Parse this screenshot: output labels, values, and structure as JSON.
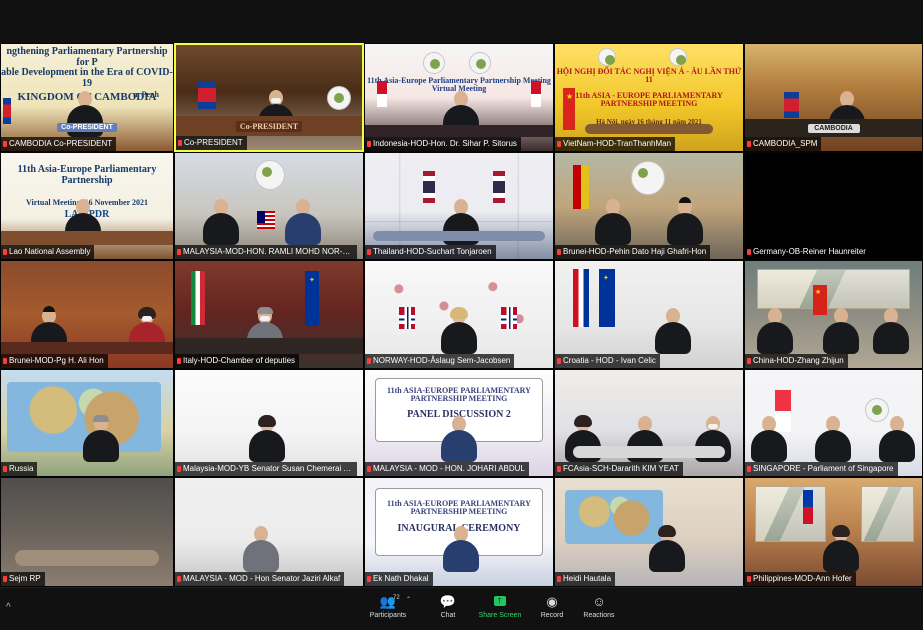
{
  "toolbar": {
    "left_chevron": "^",
    "participants_label": "Participants",
    "participants_count": "72",
    "chat_label": "Chat",
    "share_screen_label": "Share Screen",
    "record_label": "Record",
    "reactions_label": "Reactions"
  },
  "tiles": [
    {
      "label": "CAMBODIA Co-PRESIDENT",
      "banner": [
        "ngthening Parliamentary Partnership for P",
        "able Development in the Era of COVID-19",
        "KINGDOM OF CAMBODIA",
        "16 N",
        "m Penh"
      ],
      "nameplate": "Co-PRESIDENT",
      "colors": {
        "accent": "#173a67"
      }
    },
    {
      "label": "Co-PRESIDENT",
      "nameplate": "Co-PRESIDENT",
      "colors": {
        "accent": "#5a2d1e"
      }
    },
    {
      "label": "Indonesia-HOD-Hon. Dr. Sihar P. Sitorus",
      "banner": [
        "11th Asia-Europe Parliamentary Partnership Meeting",
        "Virtual Meeting"
      ]
    },
    {
      "label": "VietNam-HOD-TranThanhMan",
      "banner": [
        "HỘI NGHỊ ĐỐI TÁC NGHỊ VIỆN Á - ÂU LẦN THỨ 11",
        "11th ASIA - EUROPE PARLIAMENTARY PARTNERSHIP MEETING",
        "Hà Nội, ngày 16 tháng 11 năm 2021"
      ]
    },
    {
      "label": "CAMBODIA_SPM",
      "nameplate": "CAMBODIA"
    },
    {
      "label": "Lao National Assembly",
      "banner": [
        "11th Asia-Europe Parliamentary Partnership",
        "Virtual Meeting, 16 November 2021",
        "LAO PDR"
      ]
    },
    {
      "label": "MALAYSIA-MOD-HON. RAMLI MOHD NOR-HON..."
    },
    {
      "label": "Thailand-HOD-Suchart Tonjaroen"
    },
    {
      "label": "Brunei-HOD-Pehin Dato Haji Ghafri-Hon"
    },
    {
      "label": "Germany-OB-Reiner Haunreiter"
    },
    {
      "label": "Brunei-MOD-Pg H. Ali Hon"
    },
    {
      "label": "Italy-HOD-Chamber of deputies"
    },
    {
      "label": "NORWAY-HOD-Åslaug Sem-Jacobsen"
    },
    {
      "label": "Croatia - HOD - Ivan Celic"
    },
    {
      "label": "China-HOD-Zhang Zhijun"
    },
    {
      "label": "Russia"
    },
    {
      "label": "Malaysia-MOD-YB Senator Susan Chemerai Andi..."
    },
    {
      "label": "MALAYSIA - MOD - HON. JOHARI ABDUL",
      "banner": [
        "11th ASIA-EUROPE PARLIAMENTARY PARTNERSHIP MEETING",
        "PANEL DISCUSSION 2"
      ]
    },
    {
      "label": "FCAsia-SCH-Dararith KIM YEAT"
    },
    {
      "label": "SINGAPORE - Parliament of Singapore"
    },
    {
      "label": "Sejm RP"
    },
    {
      "label": "MALAYSIA - MOD - Hon Senator Jaziri Alkaf"
    },
    {
      "label": "Ek Nath Dhakal",
      "banner": [
        "11th ASIA-EUROPE PARLIAMENTARY PARTNERSHIP MEETING",
        "INAUGURAL CEREMONY"
      ]
    },
    {
      "label": "Heidi Hautala"
    },
    {
      "label": "Philippines-MOD-Ann Hofer"
    }
  ]
}
